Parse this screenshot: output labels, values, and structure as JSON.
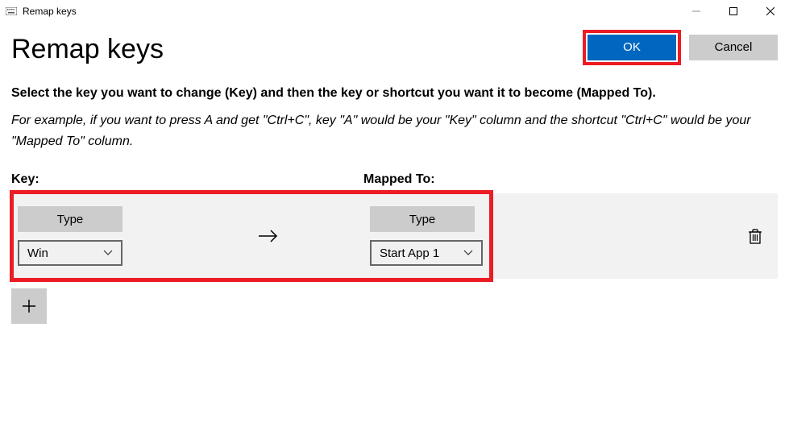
{
  "window": {
    "title": "Remap keys"
  },
  "header": {
    "title": "Remap keys",
    "ok_label": "OK",
    "cancel_label": "Cancel"
  },
  "instructions": "Select the key you want to change (Key) and then the key or shortcut you want it to become (Mapped To).",
  "example": "For example, if you want to press A and get \"Ctrl+C\", key \"A\" would be your \"Key\" column and the shortcut \"Ctrl+C\" would be your \"Mapped To\" column.",
  "columns": {
    "key": "Key:",
    "mapped": "Mapped To:"
  },
  "row": {
    "type_label": "Type",
    "key_value": "Win",
    "mapped_value": "Start App 1"
  }
}
